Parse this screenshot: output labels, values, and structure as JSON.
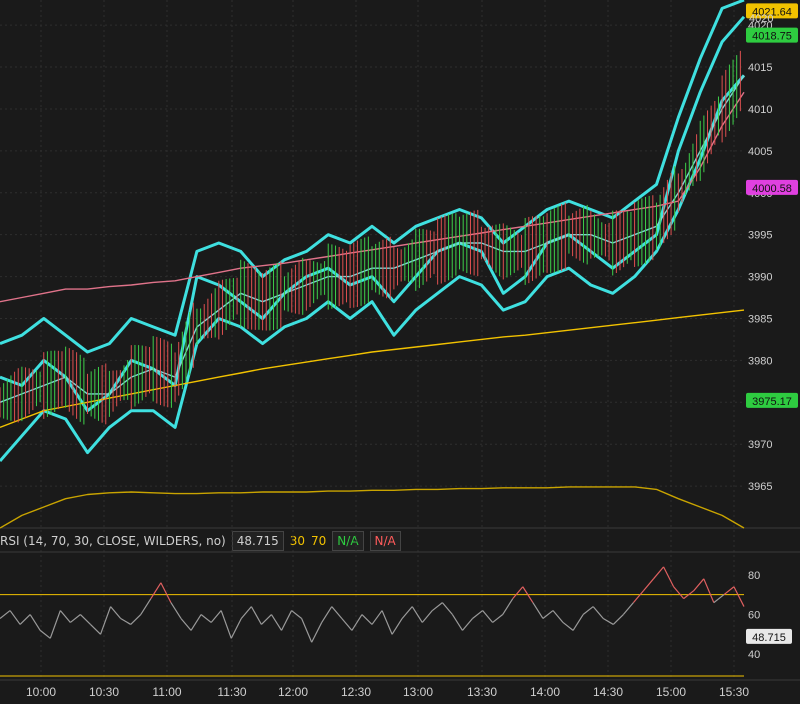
{
  "chart_data": [
    {
      "type": "line",
      "title": "",
      "x_ticks": [
        "10:00",
        "10:30",
        "11:00",
        "11:30",
        "12:00",
        "12:30",
        "13:00",
        "13:30",
        "14:00",
        "14:30",
        "15:00",
        "15:30"
      ],
      "y_ticks": [
        3965,
        3970,
        3975,
        3980,
        3985,
        3990,
        3995,
        4000,
        4005,
        4010,
        4015,
        4020
      ],
      "ylim": [
        3960,
        4023
      ],
      "grid": true,
      "price_tags": [
        {
          "value": "4021.64",
          "color": "#f2c200"
        },
        {
          "value": "4018.75",
          "color": "#2ecc40"
        },
        {
          "value": "4000.58",
          "color": "#e040e0"
        },
        {
          "value": "3975.17",
          "color": "#2ecc40"
        }
      ],
      "series": [
        {
          "color": "#3fe0e0",
          "values": [
            3978,
            3977,
            3980,
            3978,
            3974,
            3976,
            3980,
            3979,
            3977,
            3990,
            3989,
            3987,
            3985,
            3988,
            3990,
            3991,
            3989,
            3990,
            3987,
            3990,
            3993,
            3994,
            3993,
            3988,
            3990,
            3994,
            3995,
            3993,
            3991,
            3993,
            3995,
            4005,
            4012,
            4018,
            4021
          ]
        },
        {
          "color": "#3fe0e0",
          "values": [
            3982,
            3983,
            3985,
            3983,
            3981,
            3982,
            3985,
            3984,
            3983,
            3993,
            3994,
            3993,
            3990,
            3992,
            3993,
            3995,
            3994,
            3996,
            3994,
            3996,
            3997,
            3998,
            3997,
            3994,
            3996,
            3998,
            3999,
            3998,
            3997,
            3999,
            4001,
            4009,
            4016,
            4022,
            4023
          ]
        },
        {
          "color": "#3fe0e0",
          "values": [
            3968,
            3971,
            3974,
            3973,
            3969,
            3972,
            3974,
            3974,
            3972,
            3982,
            3985,
            3984,
            3982,
            3984,
            3985,
            3987,
            3985,
            3987,
            3983,
            3986,
            3988,
            3990,
            3989,
            3986,
            3987,
            3990,
            3991,
            3989,
            3988,
            3990,
            3993,
            3998,
            4004,
            4011,
            4014
          ]
        },
        {
          "color": "#7fd6d6",
          "values": [
            3975,
            3976,
            3977,
            3978,
            3976,
            3976,
            3978,
            3979,
            3978,
            3984,
            3986,
            3988,
            3987,
            3988,
            3989,
            3990,
            3990,
            3991,
            3991,
            3992,
            3993,
            3994,
            3994,
            3993,
            3993,
            3994,
            3995,
            3995,
            3994,
            3995,
            3996,
            4000,
            4005,
            4010,
            4014
          ]
        },
        {
          "color": "#e0738a",
          "values": [
            3987,
            3987.5,
            3988,
            3988.5,
            3988.5,
            3988.8,
            3989,
            3989.3,
            3989.5,
            3990,
            3990.5,
            3991,
            3991.3,
            3991.6,
            3992,
            3992.4,
            3992.8,
            3993.2,
            3993.6,
            3994,
            3994.4,
            3994.8,
            3995.2,
            3995.6,
            3996,
            3996.4,
            3996.8,
            3997.2,
            3997.6,
            3998,
            3998.4,
            3999,
            4003,
            4008,
            4012
          ]
        },
        {
          "color": "#f2c200",
          "values": [
            3972,
            3973,
            3974,
            3974.5,
            3975,
            3975.5,
            3976,
            3976.5,
            3977,
            3977.5,
            3978,
            3978.5,
            3979,
            3979.4,
            3979.8,
            3980.2,
            3980.6,
            3981,
            3981.3,
            3981.6,
            3981.9,
            3982.2,
            3982.5,
            3982.8,
            3983,
            3983.3,
            3983.6,
            3983.9,
            3984.2,
            3984.5,
            3984.8,
            3985.1,
            3985.4,
            3985.7,
            3986
          ]
        },
        {
          "color": "#c9a400",
          "values": [
            3960,
            3961.5,
            3962.5,
            3963.5,
            3964,
            3964.2,
            3964.3,
            3964.2,
            3964.1,
            3964.1,
            3964.2,
            3964.2,
            3964.3,
            3964.3,
            3964.3,
            3964.4,
            3964.4,
            3964.5,
            3964.5,
            3964.6,
            3964.6,
            3964.7,
            3964.7,
            3964.8,
            3964.8,
            3964.8,
            3964.9,
            3964.9,
            3964.9,
            3964.9,
            3964.6,
            3963.5,
            3962.5,
            3961.5,
            3960
          ]
        }
      ]
    },
    {
      "type": "line",
      "title": "",
      "study_label": "RSI (14, 70, 30, CLOSE, WILDERS, no)",
      "current_value": "48.715",
      "level_low": "30",
      "level_high": "70",
      "flag_green": "N/A",
      "flag_red": "N/A",
      "y_ticks": [
        40,
        60,
        80
      ],
      "ylim": [
        28,
        90
      ],
      "overbought": 70,
      "series": [
        {
          "color": "#9a9a9a",
          "values": [
            58,
            62,
            55,
            60,
            52,
            48,
            62,
            56,
            60,
            55,
            50,
            64,
            58,
            55,
            60,
            68,
            76,
            66,
            58,
            52,
            60,
            56,
            62,
            48,
            58,
            64,
            55,
            60,
            52,
            62,
            58,
            46,
            56,
            64,
            58,
            52,
            60,
            55,
            62,
            50,
            58,
            64,
            56,
            62,
            66,
            60,
            52,
            58,
            62,
            56,
            60,
            68,
            74,
            66,
            58,
            62,
            56,
            52,
            60,
            64,
            58,
            55,
            60,
            66,
            72,
            78,
            84,
            74,
            68,
            72,
            78,
            66,
            70,
            74,
            64
          ]
        }
      ]
    }
  ],
  "price_axis_extra": "4020"
}
